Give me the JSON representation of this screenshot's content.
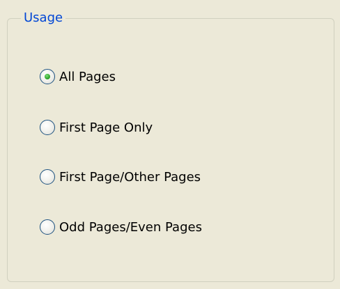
{
  "groupbox": {
    "title": "Usage"
  },
  "options": [
    {
      "label": "All Pages",
      "selected": true
    },
    {
      "label": "First Page Only",
      "selected": false
    },
    {
      "label": "First Page/Other Pages",
      "selected": false
    },
    {
      "label": "Odd Pages/Even Pages",
      "selected": false
    }
  ],
  "colors": {
    "background": "#ece9d8",
    "title_text": "#0046d5",
    "radio_border": "#1c5180",
    "selected_dot": "#2fa52a"
  },
  "icons": {
    "radio_selected": "radio-selected-icon",
    "radio_unselected": "radio-unselected-icon"
  }
}
